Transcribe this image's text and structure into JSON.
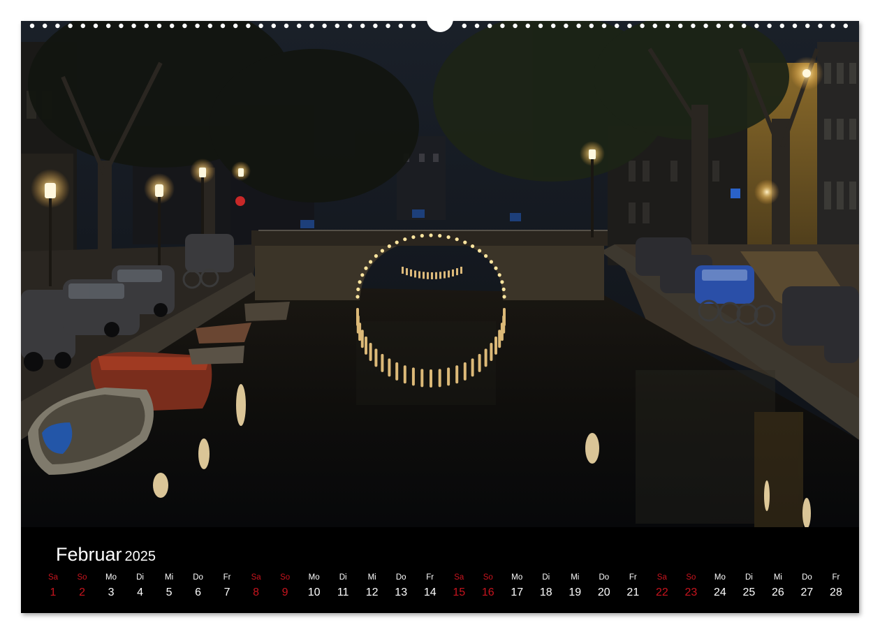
{
  "calendar": {
    "month": "Februar",
    "year": "2025",
    "days": [
      {
        "weekday": "Sa",
        "date": "1",
        "weekend": true
      },
      {
        "weekday": "So",
        "date": "2",
        "weekend": true
      },
      {
        "weekday": "Mo",
        "date": "3",
        "weekend": false
      },
      {
        "weekday": "Di",
        "date": "4",
        "weekend": false
      },
      {
        "weekday": "Mi",
        "date": "5",
        "weekend": false
      },
      {
        "weekday": "Do",
        "date": "6",
        "weekend": false
      },
      {
        "weekday": "Fr",
        "date": "7",
        "weekend": false
      },
      {
        "weekday": "Sa",
        "date": "8",
        "weekend": true
      },
      {
        "weekday": "So",
        "date": "9",
        "weekend": true
      },
      {
        "weekday": "Mo",
        "date": "10",
        "weekend": false
      },
      {
        "weekday": "Di",
        "date": "11",
        "weekend": false
      },
      {
        "weekday": "Mi",
        "date": "12",
        "weekend": false
      },
      {
        "weekday": "Do",
        "date": "13",
        "weekend": false
      },
      {
        "weekday": "Fr",
        "date": "14",
        "weekend": false
      },
      {
        "weekday": "Sa",
        "date": "15",
        "weekend": true
      },
      {
        "weekday": "So",
        "date": "16",
        "weekend": true
      },
      {
        "weekday": "Mo",
        "date": "17",
        "weekend": false
      },
      {
        "weekday": "Di",
        "date": "18",
        "weekend": false
      },
      {
        "weekday": "Mi",
        "date": "19",
        "weekend": false
      },
      {
        "weekday": "Do",
        "date": "20",
        "weekend": false
      },
      {
        "weekday": "Fr",
        "date": "21",
        "weekend": false
      },
      {
        "weekday": "Sa",
        "date": "22",
        "weekend": true
      },
      {
        "weekday": "So",
        "date": "23",
        "weekend": true
      },
      {
        "weekday": "Mo",
        "date": "24",
        "weekend": false
      },
      {
        "weekday": "Di",
        "date": "25",
        "weekend": false
      },
      {
        "weekday": "Mi",
        "date": "26",
        "weekend": false
      },
      {
        "weekday": "Do",
        "date": "27",
        "weekend": false
      },
      {
        "weekday": "Fr",
        "date": "28",
        "weekend": false
      }
    ]
  },
  "colors": {
    "weekend": "#c8141e",
    "weekday": "#ffffff",
    "background": "#000000"
  }
}
